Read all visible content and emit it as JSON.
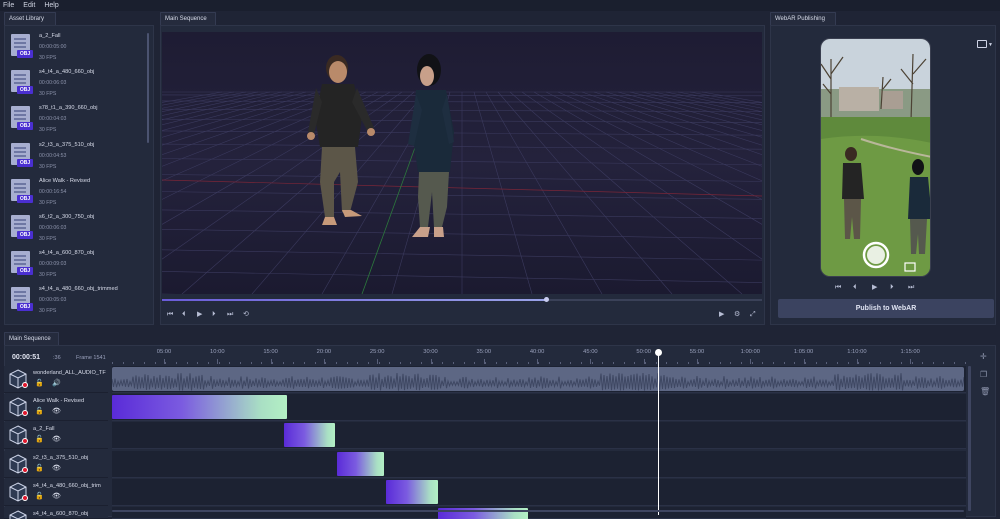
{
  "menu": [
    "File",
    "Edit",
    "Help"
  ],
  "tabs": {
    "asset_library": "Asset Library",
    "main_sequence_viewport": "Main Sequence",
    "webar": "WebAR Publishing",
    "main_sequence_timeline": "Main Sequence"
  },
  "assets": [
    {
      "name": "a_2_Fall",
      "duration": "00:00:05:00",
      "fps": "30 FPS",
      "badge": "OBJ"
    },
    {
      "name": "s4_t4_a_480_660_obj",
      "duration": "00:00:06:03",
      "fps": "30 FPS",
      "badge": "OBJ"
    },
    {
      "name": "s78_t1_a_390_660_obj",
      "duration": "00:00:04:03",
      "fps": "30 FPS",
      "badge": "OBJ"
    },
    {
      "name": "s2_t3_a_375_510_obj",
      "duration": "00:00:04:53",
      "fps": "30 FPS",
      "badge": "OBJ"
    },
    {
      "name": "Alice Walk - Revised",
      "duration": "00:00:16:54",
      "fps": "30 FPS",
      "badge": "OBJ"
    },
    {
      "name": "s6_t2_a_300_750_obj",
      "duration": "00:00:06:03",
      "fps": "30 FPS",
      "badge": "OBJ"
    },
    {
      "name": "s4_t4_a_600_870_obj",
      "duration": "00:00:09:03",
      "fps": "30 FPS",
      "badge": "OBJ"
    },
    {
      "name": "s4_t4_a_480_660_obj_trimmed",
      "duration": "00:00:05:03",
      "fps": "30 FPS",
      "badge": "OBJ"
    }
  ],
  "viewport": {
    "scrub_progress": 0.64,
    "controls": [
      "⏮",
      "⏴",
      "▶",
      "⏵",
      "⏭",
      "⟲"
    ],
    "right_controls": [
      "▶",
      "⚙",
      "⤢"
    ]
  },
  "webar": {
    "controls": [
      "⏮",
      "⏴",
      "▶",
      "⏵",
      "⏭"
    ],
    "publish_label": "Publish to WebAR"
  },
  "timeline": {
    "timecode": "00:00:51",
    "frames": ":36",
    "frame_label": "Frame 1541",
    "ruler": [
      "05:00",
      "10:00",
      "15:00",
      "20:00",
      "25:00",
      "30:00",
      "35:00",
      "40:00",
      "45:00",
      "50:00",
      "55:00",
      "1:00:00",
      "1:05:00",
      "1:10:00",
      "1:15:00"
    ],
    "playhead_fraction": 0.6414,
    "tracks": [
      {
        "name": "wonderland_ALL_AUDIO_TF",
        "type": "audio",
        "clip_start": 0.0,
        "clip_end": 1.0
      },
      {
        "name": "Alice Walk - Revised",
        "type": "video",
        "clip_start": 0.0,
        "clip_end": 0.2054
      },
      {
        "name": "a_2_Fall",
        "type": "video",
        "clip_start": 0.2023,
        "clip_end": 0.2617
      },
      {
        "name": "s2_t3_a_375_510_obj",
        "type": "video",
        "clip_start": 0.2641,
        "clip_end": 0.3193
      },
      {
        "name": "s4_t4_a_480_660_obj_trim",
        "type": "video",
        "clip_start": 0.3216,
        "clip_end": 0.3829
      },
      {
        "name": "s4_t4_a_600_870_obj",
        "type": "video",
        "clip_start": 0.3829,
        "clip_end": 0.4883
      }
    ]
  },
  "colors": {
    "background": "#1f2435",
    "panel": "#232a3c",
    "accent_purple": "#5a2bd8",
    "accent_green": "#b3f0c4",
    "record": "#e0182e"
  }
}
